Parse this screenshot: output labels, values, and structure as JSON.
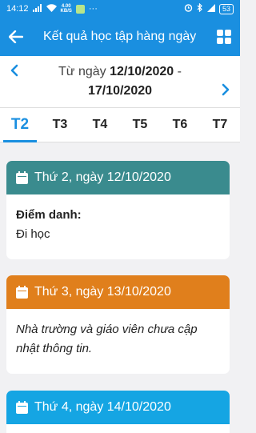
{
  "status_bar": {
    "time": "14:12",
    "net_speed_value": "4.00",
    "net_speed_unit": "KB/S",
    "battery": "53",
    "overflow": "···"
  },
  "appbar": {
    "title": "Kết quả học tập hàng ngày"
  },
  "date_range": {
    "prefix": "Từ ngày ",
    "start": "12/10/2020",
    "separator": " -",
    "end": "17/10/2020"
  },
  "tabs": [
    {
      "label": "T2",
      "active": true
    },
    {
      "label": "T3"
    },
    {
      "label": "T4"
    },
    {
      "label": "T5"
    },
    {
      "label": "T6"
    },
    {
      "label": "T7"
    }
  ],
  "cards": [
    {
      "header": "Thứ 2, ngày 12/10/2020",
      "color": "#3a8b8e",
      "label": "Điểm danh:",
      "value": "Đi học"
    },
    {
      "header": "Thứ 3, ngày 13/10/2020",
      "color": "#e07f1c",
      "note": "Nhà trường và giáo viên chưa cập nhật thông tin."
    },
    {
      "header": "Thứ 4, ngày 14/10/2020",
      "color": "#15a5e3"
    }
  ],
  "colors": {
    "primary": "#1a8fe0",
    "background": "#f1f1f3"
  }
}
